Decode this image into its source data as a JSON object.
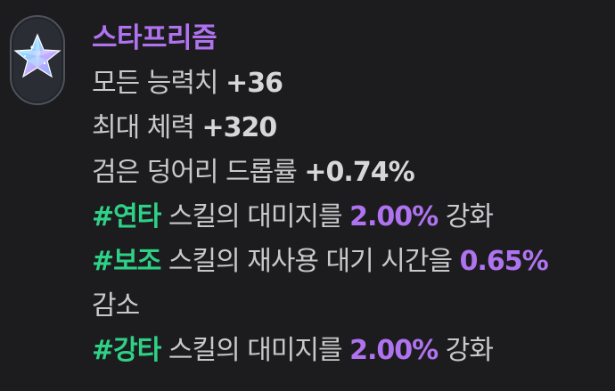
{
  "item": {
    "name": "스타프리즘",
    "icon": "star-prism-icon"
  },
  "stats": {
    "all_stats_label": "모든 능력치 ",
    "all_stats_value": "+36",
    "max_hp_label": "최대 체력 ",
    "max_hp_value": "+320",
    "drop_rate_label": "검은 덩어리 드롭률 ",
    "drop_rate_value": "+0.74%"
  },
  "effects": [
    {
      "tag": "#연타",
      "text_before": " 스킬의 대미지를 ",
      "value": "2.00%",
      "text_after": " 강화"
    },
    {
      "tag": "#보조",
      "text_before": " 스킬의 재사용 대기 시간을 ",
      "value": "0.65%",
      "text_after": "감소"
    },
    {
      "tag": "#강타",
      "text_before": " 스킬의 대미지를 ",
      "value": "2.00%",
      "text_after": " 강화"
    }
  ],
  "colors": {
    "title": "#b073f0",
    "tag": "#2fd187",
    "percent": "#b073f0",
    "text": "#c9c9cc",
    "background": "#1c1c1e"
  }
}
